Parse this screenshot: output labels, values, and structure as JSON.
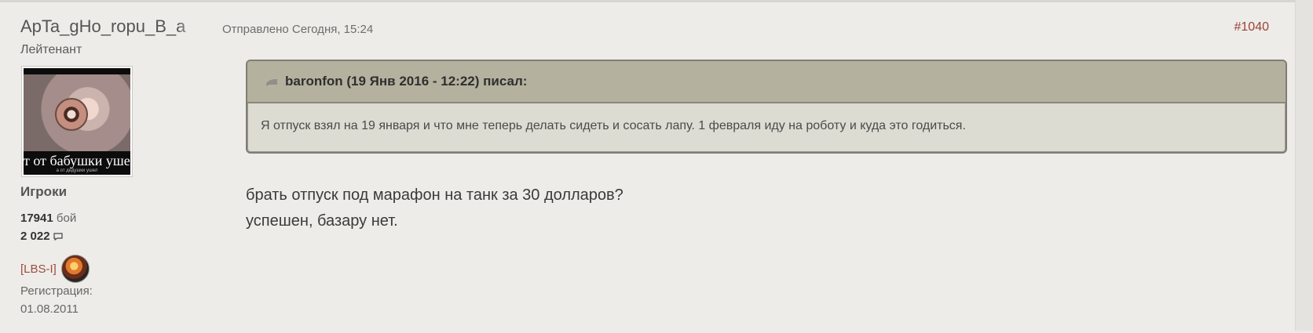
{
  "author": {
    "name": "ApTa_gHo_ropu_B_a",
    "rank": "Лейтенант",
    "group": "Игроки",
    "battles": "17941",
    "battles_label": "бой",
    "posts": "2 022",
    "clan": "[LBS-I]",
    "registration_label": "Регистрация:",
    "registration_date": "01.08.2011",
    "avatar_caption": "т от бабушки уше.",
    "avatar_caption_small": "а от дедушки ушел"
  },
  "post": {
    "meta": "Отправлено Сегодня, 15:24",
    "number": "#1040"
  },
  "quote": {
    "author": "baronfon (19 Янв 2016 - 12:22) писал:",
    "text": "Я отпуск взял на 19 января и что мне теперь делать сидеть и сосать лапу. 1 февраля иду на роботу и куда это годиться."
  },
  "message": {
    "lines": [
      "брать отпуск под марафон на танк за 30 долларов?",
      "успешен, базару нет."
    ]
  },
  "icons": {
    "posts_icon": "comment-icon",
    "quote_icon": "quote-icon"
  }
}
